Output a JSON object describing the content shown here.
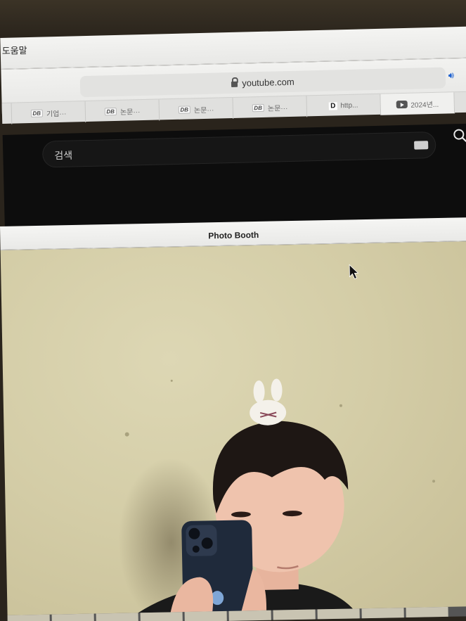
{
  "menubar": {
    "help_label": "도움말"
  },
  "browser": {
    "url": "youtube.com",
    "tabs": [
      {
        "label": "기업···",
        "favicon": "DB"
      },
      {
        "label": "논문···",
        "favicon": "DB"
      },
      {
        "label": "논문···",
        "favicon": "DB"
      },
      {
        "label": "논문···",
        "favicon": "DB"
      },
      {
        "label": "http...",
        "favicon": "D"
      },
      {
        "label": "2024년...",
        "favicon": "youtube-icon"
      }
    ]
  },
  "youtube": {
    "search_placeholder": "검색"
  },
  "photo_booth": {
    "title": "Photo Booth"
  },
  "colors": {
    "yt_bg": "#0d0d0d",
    "wall": "#d4cda7",
    "speaker": "#1a5fd0"
  }
}
